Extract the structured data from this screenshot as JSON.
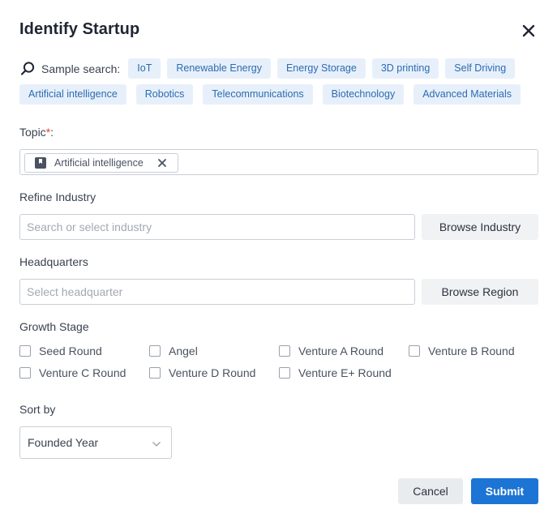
{
  "dialog": {
    "title": "Identify Startup",
    "close_icon": "close-icon"
  },
  "sample_search": {
    "icon": "search-icon",
    "label": "Sample search:",
    "chips_row1": [
      "IoT",
      "Renewable Energy",
      "Energy Storage",
      "3D printing",
      "Self Driving"
    ],
    "chips_row2": [
      "Artificial intelligence",
      "Robotics",
      "Telecommunications",
      "Biotechnology",
      "Advanced Materials"
    ]
  },
  "topic": {
    "label": "Topic",
    "required_mark": "*",
    "suffix": ":",
    "tag": {
      "icon": "bookmark-icon",
      "label": "Artificial intelligence",
      "remove_icon": "close-icon"
    }
  },
  "refine_industry": {
    "label": "Refine Industry",
    "placeholder": "Search or select industry",
    "value": "",
    "browse_label": "Browse Industry"
  },
  "headquarters": {
    "label": "Headquarters",
    "placeholder": "Select headquarter",
    "value": "",
    "browse_label": "Browse Region"
  },
  "growth_stage": {
    "label": "Growth Stage",
    "options": [
      {
        "label": "Seed Round",
        "checked": false
      },
      {
        "label": "Angel",
        "checked": false
      },
      {
        "label": "Venture A Round",
        "checked": false
      },
      {
        "label": "Venture B Round",
        "checked": false
      },
      {
        "label": "Venture C Round",
        "checked": false
      },
      {
        "label": "Venture D Round",
        "checked": false
      },
      {
        "label": "Venture E+ Round",
        "checked": false
      }
    ]
  },
  "sort_by": {
    "label": "Sort by",
    "selected": "Founded Year",
    "icon": "chevron-down-icon"
  },
  "actions": {
    "cancel_label": "Cancel",
    "submit_label": "Submit"
  },
  "colors": {
    "accent": "#1c74d4",
    "chip_bg": "#e7f0fa",
    "chip_text": "#2b6bb3",
    "required": "#e0413a"
  }
}
